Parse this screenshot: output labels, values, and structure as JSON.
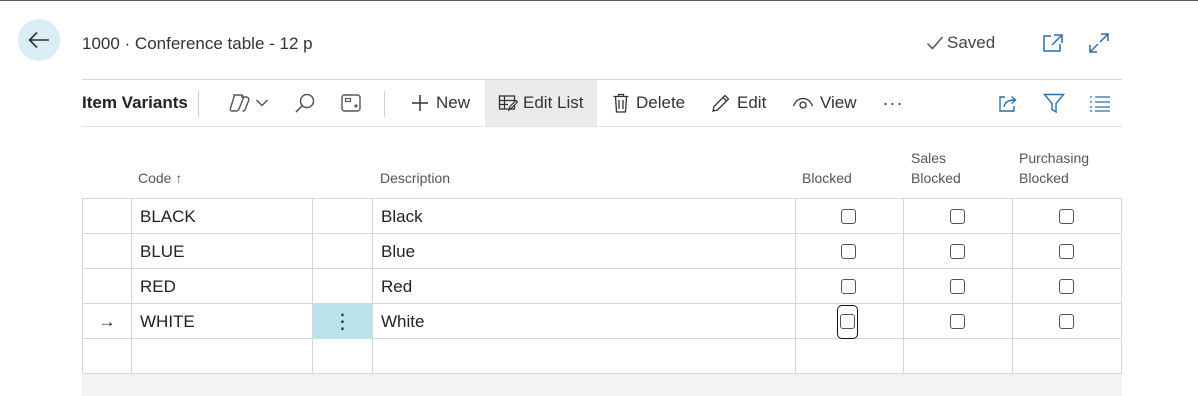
{
  "header": {
    "title": "1000 · Conference table - 12 p",
    "saved_label": "Saved"
  },
  "toolbar": {
    "caption": "Item Variants",
    "new_label": "New",
    "edit_list_label": "Edit List",
    "delete_label": "Delete",
    "edit_label": "Edit",
    "view_label": "View",
    "more_label": "···"
  },
  "columns": {
    "code": "Code",
    "code_sort": "↑",
    "description": "Description",
    "blocked": "Blocked",
    "sales_blocked_1": "Sales",
    "sales_blocked_2": "Blocked",
    "purchasing_blocked_1": "Purchasing",
    "purchasing_blocked_2": "Blocked"
  },
  "rows": [
    {
      "code": "BLACK",
      "description": "Black",
      "blocked": false,
      "sales_blocked": false,
      "purchasing_blocked": false
    },
    {
      "code": "BLUE",
      "description": "Blue",
      "blocked": false,
      "sales_blocked": false,
      "purchasing_blocked": false
    },
    {
      "code": "RED",
      "description": "Red",
      "blocked": false,
      "sales_blocked": false,
      "purchasing_blocked": false
    },
    {
      "code": "WHITE",
      "description": "White",
      "blocked": false,
      "sales_blocked": false,
      "purchasing_blocked": false,
      "current": true
    }
  ],
  "row_marker": "→",
  "row_menu": "⋮",
  "colors": {
    "accent": "#d9eef2",
    "selected_cell": "#b9e2ea",
    "active_button": "#ebebeb"
  }
}
